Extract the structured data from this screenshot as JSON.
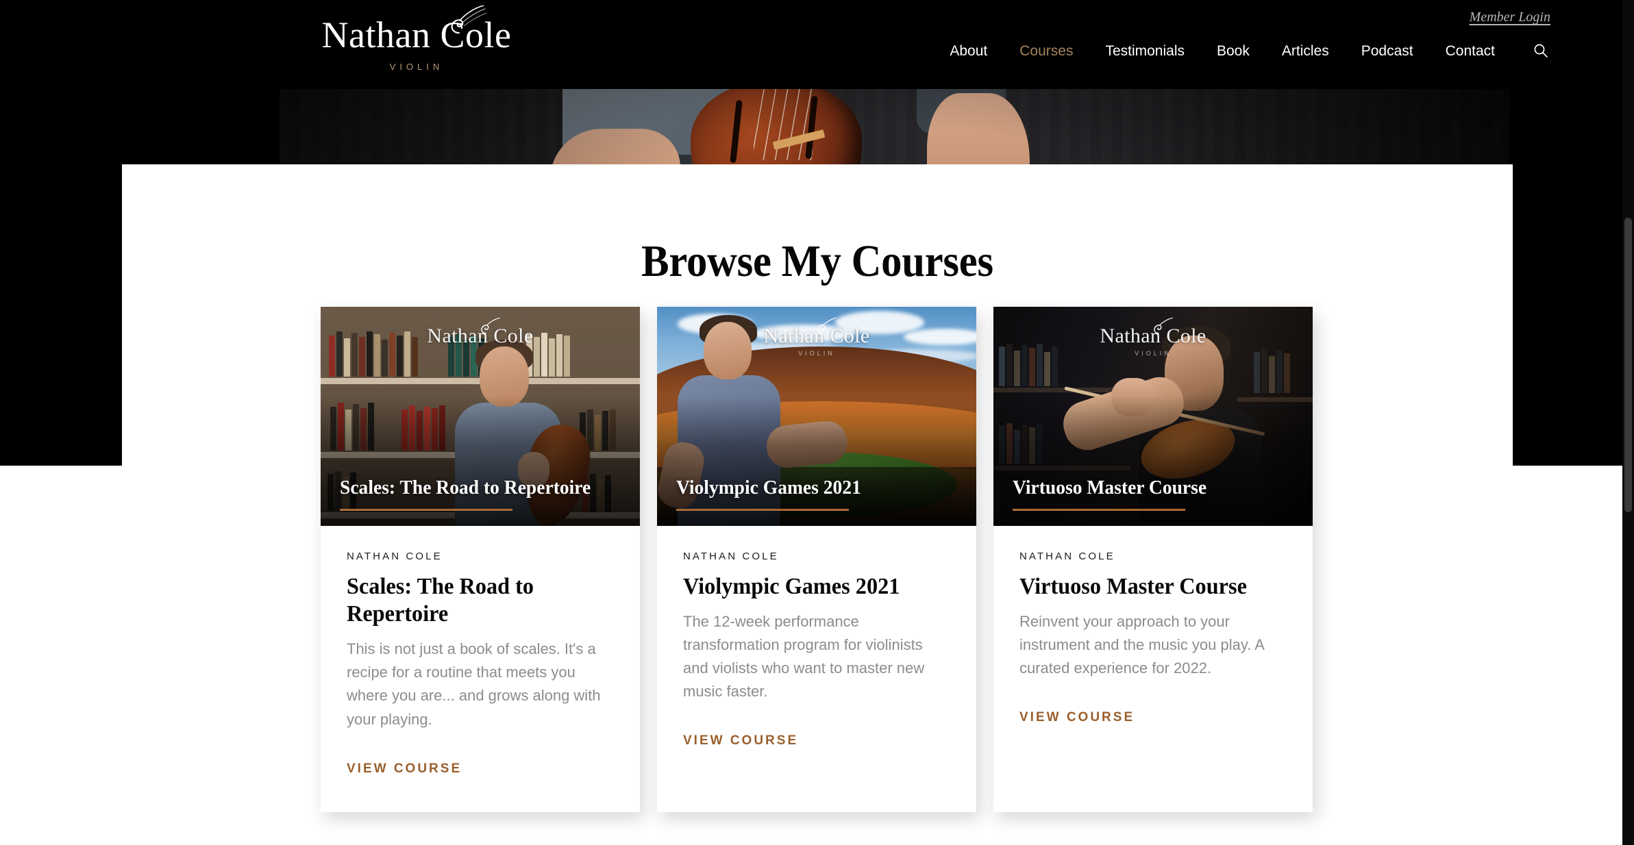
{
  "brand": {
    "name": "Nathan Cole",
    "tagline": "VIOLIN"
  },
  "header": {
    "member_login": "Member Login",
    "nav": [
      {
        "label": "About",
        "active": false
      },
      {
        "label": "Courses",
        "active": true
      },
      {
        "label": "Testimonials",
        "active": false
      },
      {
        "label": "Book",
        "active": false
      },
      {
        "label": "Articles",
        "active": false
      },
      {
        "label": "Podcast",
        "active": false
      },
      {
        "label": "Contact",
        "active": false
      }
    ],
    "search_icon": "search-icon",
    "accent_color": "#a5835d",
    "background_color": "#000000"
  },
  "main": {
    "section_title": "Browse My Courses",
    "cards": [
      {
        "overlay_title": "Scales: The Road to Repertoire",
        "eyebrow": "NATHAN COLE",
        "title": "Scales: The Road to Repertoire",
        "description": "This is not just a book of scales. It's a recipe for a routine that meets you where you are... and grows along with your playing.",
        "cta": "VIEW COURSE",
        "image_alt": "man-in-blue-polo-holding-violin-in-library"
      },
      {
        "overlay_title": "Violympic Games 2021",
        "eyebrow": "NATHAN COLE",
        "title": "Violympic Games 2021",
        "description": "The 12-week performance transformation program for violinists and violists who want to master new music faster.",
        "cta": "VIEW COURSE",
        "image_alt": "man-in-blue-shirt-gesturing-in-stadium"
      },
      {
        "overlay_title": "Virtuoso Master Course",
        "eyebrow": "NATHAN COLE",
        "title": "Virtuoso Master Course",
        "description": "Reinvent your approach to your instrument and the music you play. A curated experience for 2022.",
        "cta": "VIEW COURSE",
        "image_alt": "man-playing-violin-in-dark-library"
      }
    ]
  },
  "colors": {
    "cta": "#9a5f2c",
    "rule": "#a96b36",
    "body_text": "#8c8c8c",
    "panel": "#ffffff"
  }
}
